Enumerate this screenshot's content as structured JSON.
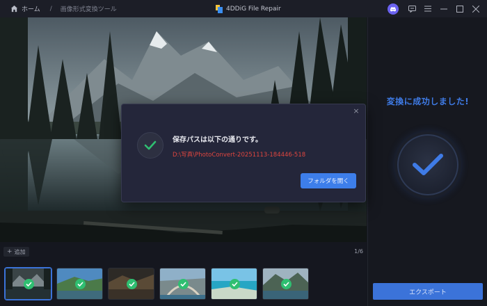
{
  "titlebar": {
    "home_label": "ホーム",
    "separator": "/",
    "current_page": "画像形式変換ツール",
    "app_title": "4DDiG File Repair"
  },
  "dialog": {
    "heading": "保存パスは以下の通りです。",
    "path": "D:\\写真\\PhotoConvert-20251113-184446-518",
    "open_folder_label": "フォルダを開く",
    "close_icon": "×"
  },
  "right_panel": {
    "success_text": "変換に成功しました!",
    "export_label": "エクスポート"
  },
  "toolbar": {
    "add_label": "追加",
    "add_icon": "+",
    "page_count": "1/6"
  },
  "icons": {
    "home": "home-icon",
    "discord": "discord-icon",
    "feedback": "feedback-icon",
    "menu": "menu-icon",
    "minimize": "minimize-icon",
    "maximize": "maximize-icon",
    "close": "close-icon",
    "check": "check-icon"
  },
  "colors": {
    "accent": "#3d7eea",
    "success": "#2fbf71",
    "error_path": "#e0463f",
    "background": "#15171f"
  },
  "thumbnails": [
    {
      "selected": true
    },
    {
      "selected": false
    },
    {
      "selected": false
    },
    {
      "selected": false
    },
    {
      "selected": false
    },
    {
      "selected": false
    }
  ]
}
